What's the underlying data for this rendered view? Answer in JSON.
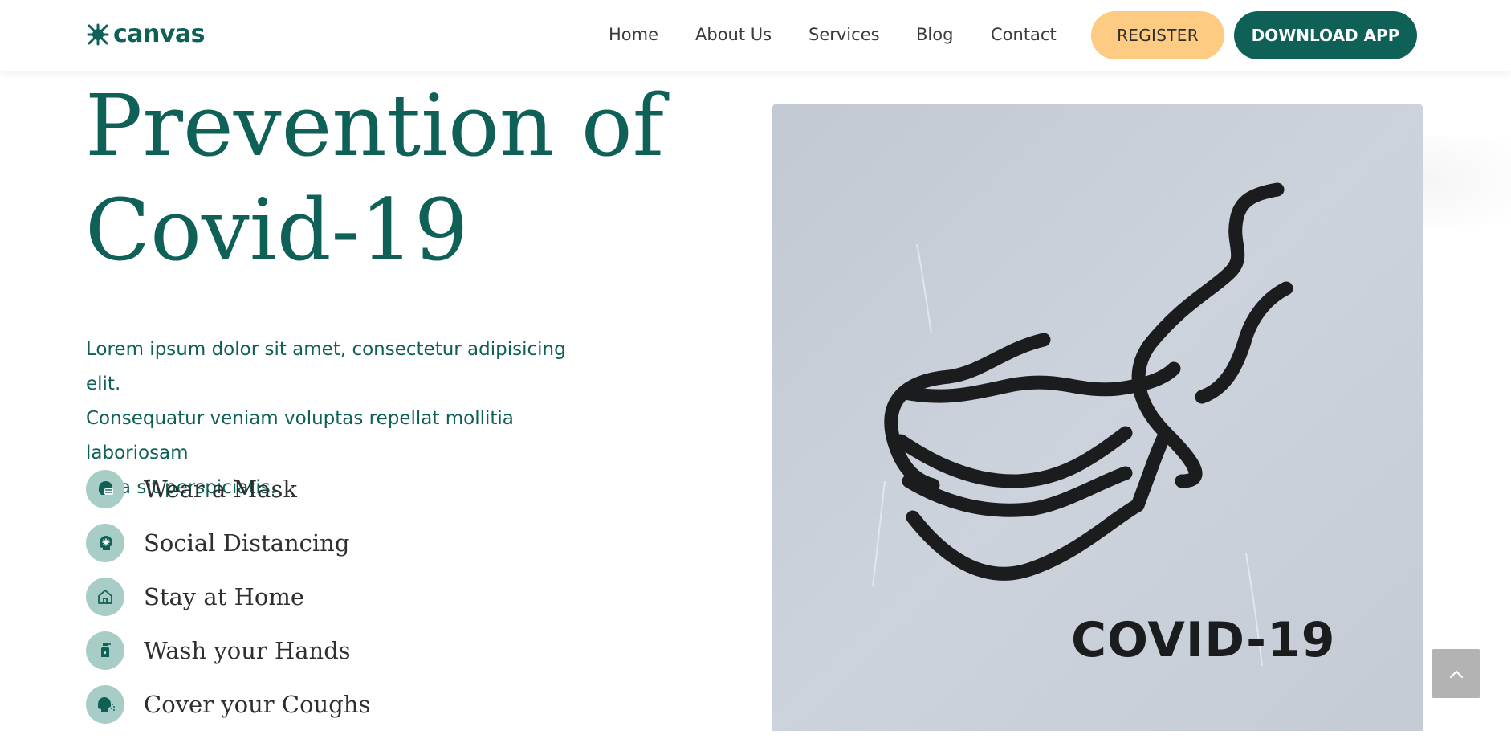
{
  "header": {
    "logo_text": "canvas",
    "nav": [
      "Home",
      "About Us",
      "Services",
      "Blog",
      "Contact"
    ],
    "register_label": "REGISTER",
    "download_label": "DOWNLOAD APP"
  },
  "hero": {
    "title_line1": "Prevention of",
    "title_line2": "Covid-19",
    "description_lines": [
      "Lorem ipsum dolor sit amet, consectetur adipisicing elit.",
      "Consequatur veniam voluptas repellat mollitia laboriosam",
      "nulla sit perspiciatis."
    ],
    "tips": [
      {
        "label": "Wear a Mask",
        "icon": "mask-icon"
      },
      {
        "label": "Social Distancing",
        "icon": "social-distancing-icon"
      },
      {
        "label": "Stay at Home",
        "icon": "home-icon"
      },
      {
        "label": "Wash your Hands",
        "icon": "hand-wash-icon"
      },
      {
        "label": "Cover your Coughs",
        "icon": "cough-icon"
      }
    ],
    "image_text": "COVID-19"
  },
  "colors": {
    "primary": "#0f6157",
    "accent": "#fecb82",
    "icon_bg": "#a8cdc6",
    "scroll_button": "#b3b3b3"
  },
  "scroll_top_icon": "chevron-up-icon"
}
